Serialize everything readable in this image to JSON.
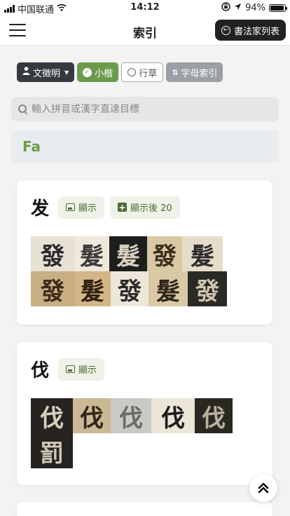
{
  "status_bar": {
    "carrier": "中国联通",
    "time": "14:12",
    "battery": "94%"
  },
  "nav": {
    "title": "索引",
    "list_button": "書法家列表"
  },
  "filters": [
    {
      "label": "文徵明",
      "style": "dark"
    },
    {
      "label": "小楷",
      "style": "green"
    },
    {
      "label": "行草",
      "style": "outline"
    },
    {
      "label": "字母索引",
      "style": "gray"
    }
  ],
  "search": {
    "placeholder": "輸入拼音或漢字直達目標"
  },
  "section": {
    "letter": "Fa"
  },
  "cards": [
    {
      "character": "发",
      "show_label": "顯示",
      "show_more_label": "顯示後 20",
      "tiles": [
        {
          "glyph": "發",
          "bg": "#e8e2d4",
          "fg": "#2a2a2a"
        },
        {
          "glyph": "髮",
          "bg": "#efe9dc",
          "fg": "#3a3a3a"
        },
        {
          "glyph": "髮",
          "bg": "#1e1e1e",
          "fg": "#d9d2c2"
        },
        {
          "glyph": "發",
          "bg": "#d8c8a3",
          "fg": "#3a2e1e"
        },
        {
          "glyph": "髮",
          "bg": "#e7dcc9",
          "fg": "#2d2d2d"
        },
        {
          "glyph": "發",
          "bg": "#c7ae83",
          "fg": "#3b2a17"
        },
        {
          "glyph": "髮",
          "bg": "#d3b686",
          "fg": "#2e2011"
        },
        {
          "glyph": "發",
          "bg": "#ede7da",
          "fg": "#2a2a2a"
        },
        {
          "glyph": "髮",
          "bg": "#dac9a5",
          "fg": "#2e2418"
        },
        {
          "glyph": "發",
          "bg": "#2a2a24",
          "fg": "#cfc6b2"
        }
      ]
    },
    {
      "character": "伐",
      "show_label": "顯示",
      "tiles": [
        {
          "glyph": "伐",
          "bg": "#262320",
          "fg": "#d8d0bf"
        },
        {
          "glyph": "伐",
          "bg": "#cbb895",
          "fg": "#2f2518"
        },
        {
          "glyph": "伐",
          "bg": "#c9c9c5",
          "fg": "#6a6a66"
        },
        {
          "glyph": "伐",
          "bg": "#ece6d8",
          "fg": "#1c1c1c"
        },
        {
          "glyph": "伐",
          "bg": "#2b2824",
          "fg": "#b9b1a0"
        },
        {
          "glyph": "罰",
          "bg": "#25221f",
          "fg": "#cfc7b6"
        }
      ]
    }
  ],
  "scroll_top_icon": "double-chevron-up-icon"
}
